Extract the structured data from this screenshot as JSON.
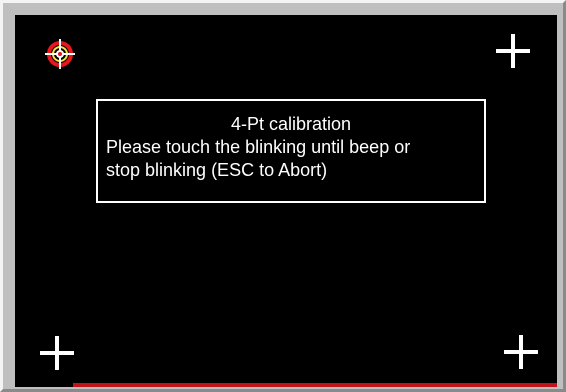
{
  "dialog": {
    "title": "4-Pt calibration",
    "line1": "Please touch the blinking until beep or",
    "line2": "stop blinking (ESC to Abort)"
  },
  "colors": {
    "background": "#000000",
    "active_target_ring": "#e8151b",
    "active_target_inner": "#f2e34a",
    "inactive_target": "#ffffff",
    "progress_bar": "#c0141a"
  },
  "targets": [
    {
      "name": "top-left",
      "state": "blinking"
    },
    {
      "name": "top-right",
      "state": "idle"
    },
    {
      "name": "bottom-left",
      "state": "idle"
    },
    {
      "name": "bottom-right",
      "state": "idle"
    }
  ]
}
